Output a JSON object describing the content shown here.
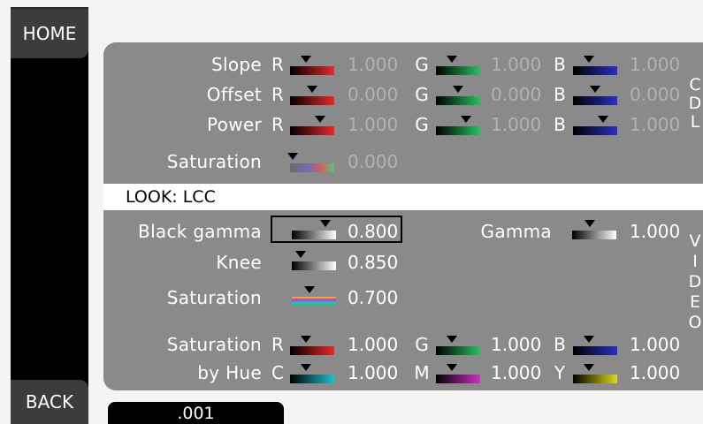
{
  "nav": {
    "home_label": "HOME",
    "back_label": "BACK"
  },
  "cdl": {
    "vertical_label": [
      "C",
      "D",
      "L"
    ],
    "rows": [
      {
        "label": "Slope",
        "r": "1.000",
        "g": "1.000",
        "b": "1.000"
      },
      {
        "label": "Offset",
        "r": "0.000",
        "g": "0.000",
        "b": "0.000"
      },
      {
        "label": "Power",
        "r": "1.000",
        "g": "1.000",
        "b": "1.000"
      }
    ],
    "saturation": {
      "label": "Saturation",
      "value": "0.000"
    },
    "channel_letters": {
      "r": "R",
      "g": "G",
      "b": "B"
    }
  },
  "look": {
    "label": "LOOK: LCC"
  },
  "video": {
    "vertical_label": [
      "V",
      "I",
      "D",
      "E",
      "O"
    ],
    "black_gamma": {
      "label": "Black gamma",
      "value": "0.800"
    },
    "gamma": {
      "label": "Gamma",
      "value": "1.000"
    },
    "knee": {
      "label": "Knee",
      "value": "0.850"
    },
    "saturation": {
      "label": "Saturation",
      "value": "0.700"
    },
    "sat_by_hue": {
      "label_line1": "Saturation",
      "label_line2": "by Hue",
      "r": "1.000",
      "g": "1.000",
      "b": "1.000",
      "c": "1.000",
      "m": "1.000",
      "y": "1.000",
      "letters": {
        "r": "R",
        "g": "G",
        "b": "B",
        "c": "C",
        "m": "M",
        "y": "Y"
      }
    }
  },
  "step": {
    "value": ".001"
  },
  "colors": {
    "red": "#e8282c",
    "green": "#28c060",
    "blue": "#2a30c0",
    "cyan": "#20c0d0",
    "magenta": "#d030c0",
    "yellow": "#e0d818",
    "panel": "#8a8a8a"
  }
}
